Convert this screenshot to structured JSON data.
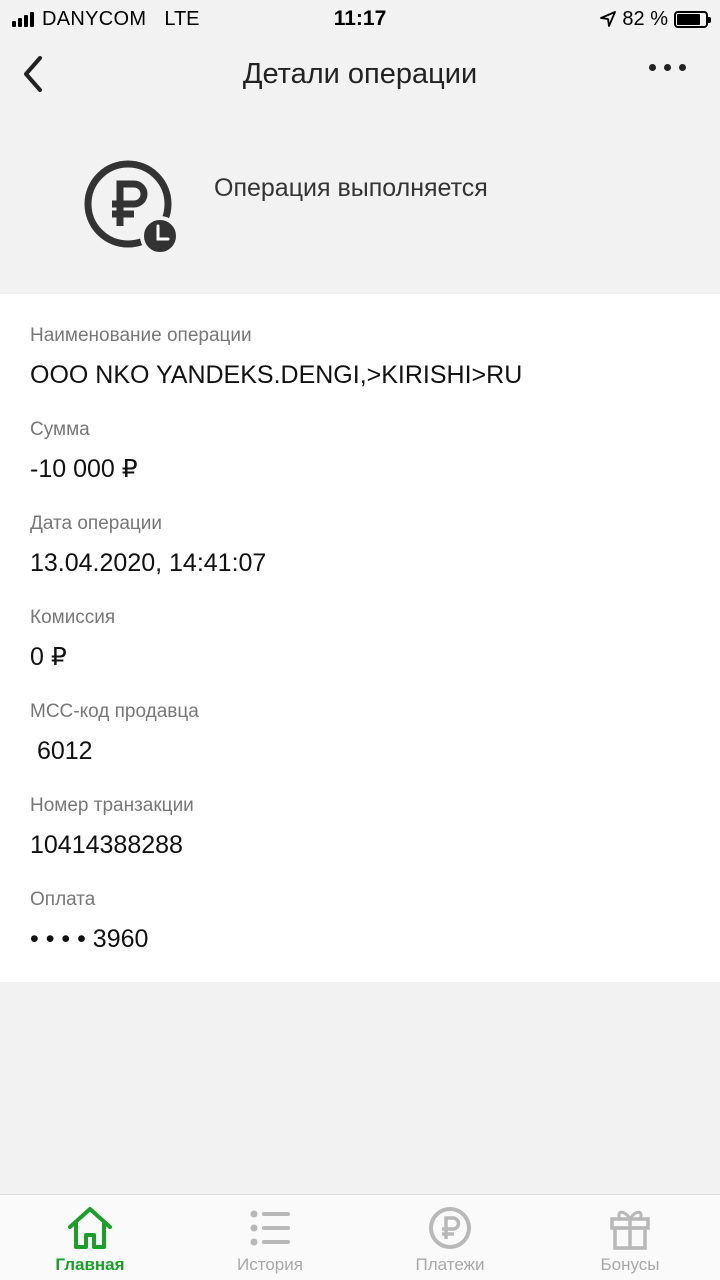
{
  "status_bar": {
    "carrier": "DANYCOM",
    "network": "LTE",
    "time": "11:17",
    "battery": "82 %",
    "battery_level": 0.82
  },
  "header": {
    "title": "Детали операции"
  },
  "operation_status": {
    "text": "Операция выполняется",
    "icon": "ruble-clock-icon"
  },
  "details": [
    {
      "label": "Наименование операции",
      "value": "ООО NKO YANDEKS.DENGI,>KIRISHI>RU"
    },
    {
      "label": "Сумма",
      "value": "-10 000 ₽"
    },
    {
      "label": "Дата операции",
      "value": "13.04.2020, 14:41:07"
    },
    {
      "label": "Комиссия",
      "value": "0 ₽"
    },
    {
      "label": "MCC-код продавца",
      "value": " 6012"
    },
    {
      "label": "Номер транзакции",
      "value": "10414388288"
    },
    {
      "label": "Оплата",
      "value": "• • • • 3960"
    }
  ],
  "tabbar": {
    "items": [
      {
        "label": "Главная",
        "icon": "home-icon",
        "active": true
      },
      {
        "label": "История",
        "icon": "list-icon",
        "active": false
      },
      {
        "label": "Платежи",
        "icon": "ruble-icon",
        "active": false
      },
      {
        "label": "Бонусы",
        "icon": "gift-icon",
        "active": false
      }
    ]
  },
  "colors": {
    "accent": "#1a9f29",
    "background": "#f2f2f2",
    "card": "#ffffff",
    "label": "#777777",
    "inactive_tab": "#a8a8a8"
  }
}
